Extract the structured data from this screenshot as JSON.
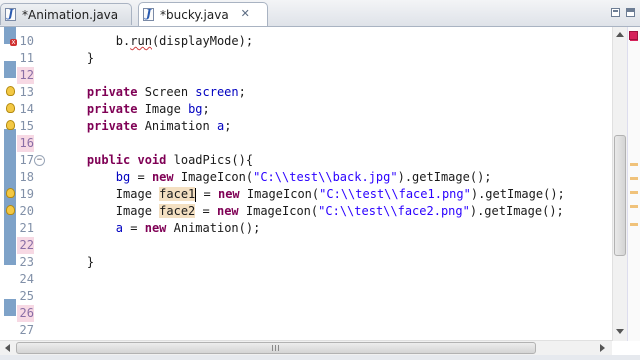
{
  "tabs": [
    {
      "label": "*Animation.java",
      "icon": "java-file-icon",
      "active": false
    },
    {
      "label": "*bucky.java",
      "icon": "java-file-icon",
      "active": true
    }
  ],
  "editor": {
    "lines": [
      {
        "num": "10",
        "code": "        b.run(displayMode);"
      },
      {
        "num": "11",
        "code": "    }"
      },
      {
        "num": "12",
        "code": ""
      },
      {
        "num": "13",
        "code": "    private Screen screen;"
      },
      {
        "num": "14",
        "code": "    private Image bg;"
      },
      {
        "num": "15",
        "code": "    private Animation a;"
      },
      {
        "num": "16",
        "code": ""
      },
      {
        "num": "17",
        "code": "    public void loadPics(){"
      },
      {
        "num": "18",
        "code": "        bg = new ImageIcon(\"C:\\\\test\\\\back.jpg\").getImage();"
      },
      {
        "num": "19",
        "code": "        Image face1 = new ImageIcon(\"C:\\\\test\\\\face1.png\").getImage();"
      },
      {
        "num": "20",
        "code": "        Image face2 = new ImageIcon(\"C:\\\\test\\\\face2.png\").getImage();"
      },
      {
        "num": "21",
        "code": "        a = new Animation();"
      },
      {
        "num": "22",
        "code": ""
      },
      {
        "num": "23",
        "code": "    }"
      },
      {
        "num": "24",
        "code": ""
      },
      {
        "num": "25",
        "code": ""
      },
      {
        "num": "26",
        "code": ""
      },
      {
        "num": "27",
        "code": ""
      }
    ]
  },
  "colors": {
    "keyword": "#7f0055",
    "field": "#0000c0",
    "string": "#2a00ff",
    "line_number": "#8190a8",
    "changed_line_bg": "#f7d9e4",
    "occurrence_highlight": "#f4e0c2",
    "error_marker": "#d5225a"
  }
}
